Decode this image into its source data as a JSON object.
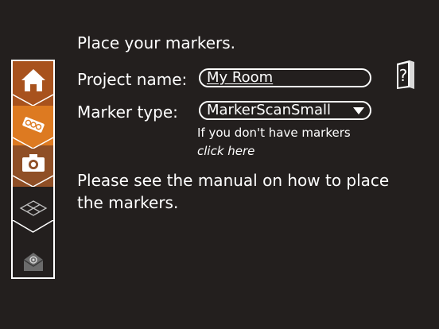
{
  "header": {
    "title": "Place your markers."
  },
  "form": {
    "project_label": "Project name:",
    "project_value": "My Room",
    "marker_label": "Marker type:",
    "marker_value": "MarkerScanSmall",
    "hint": "If you don't have markers",
    "hint_link": "click here"
  },
  "instructions": "Please see the manual on how to place the markers.",
  "sidebar": {
    "steps": [
      {
        "icon": "home-icon",
        "color": "#a8521d"
      },
      {
        "icon": "marker-tag-icon",
        "color": "#dd7a21",
        "active": true
      },
      {
        "icon": "camera-icon",
        "color": "#8f4f26"
      },
      {
        "icon": "floor-grid-icon",
        "color": "#231f1e"
      },
      {
        "icon": "mail-icon",
        "color": "#231f1e"
      }
    ]
  },
  "colors": {
    "background": "#231f1e",
    "accent": "#dd7a21",
    "text": "#ffffff"
  },
  "help": {
    "icon": "help-book-icon"
  }
}
